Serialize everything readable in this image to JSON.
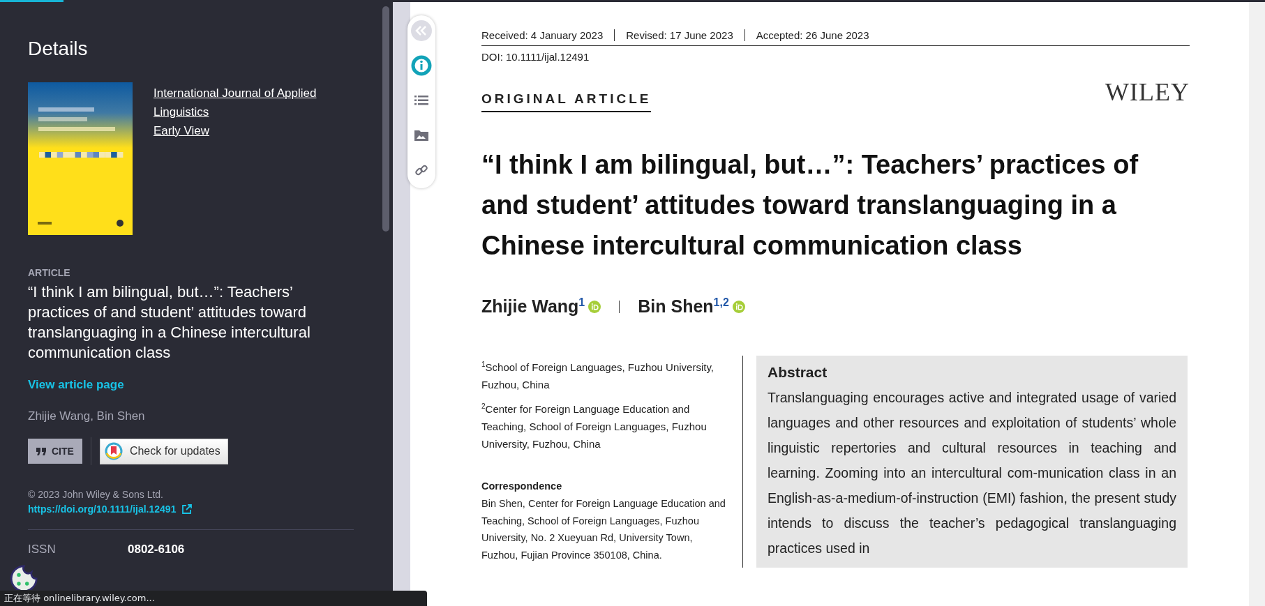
{
  "loading_bar": {
    "level": 0.05
  },
  "details": {
    "heading": "Details",
    "journal_link": "International Journal of Applied Linguistics",
    "issue_link": "Early View",
    "section_label": "ARTICLE",
    "article_title": "“I think I am bilingual, but…”: Teachers’ practices of and student’ attitudes toward translanguaging in a Chinese intercultural communication class",
    "view_link": "View article page",
    "authors": "Zhijie Wang, Bin Shen",
    "cite_button": "CITE",
    "updates_button": "Check for updates",
    "copyright": "© 2023 John Wiley & Sons Ltd.",
    "doi_link": "https://doi.org/10.1111/ijal.12491",
    "issn_label": "ISSN",
    "issn_value": "0802-6106"
  },
  "toolbar": [
    {
      "kind": "collapse",
      "selected": false
    },
    {
      "kind": "info",
      "selected": true
    },
    {
      "kind": "contents",
      "selected": false
    },
    {
      "kind": "figures",
      "selected": false
    },
    {
      "kind": "links",
      "selected": false
    }
  ],
  "article": {
    "dates": [
      "Received: 4 January 2023",
      "Revised: 17 June 2023",
      "Accepted: 26 June 2023"
    ],
    "doi": "DOI: 10.1111/ijal.12491",
    "section": "ORIGINAL ARTICLE",
    "publisher": "WILEY",
    "title": "“I think I am bilingual, but…”: Teachers’ practices of and student’ attitudes toward translanguaging in a Chinese intercultural communication class",
    "authors": [
      "Zhijie Wang$^{1}$",
      "Bin Shen$^{1,2}$"
    ],
    "affiliations": [
      "$^{1}$School of Foreign Languages, Fuzhou University, Fuzhou, China",
      "$^{2}$Center for Foreign Language Education and Teaching, School of Foreign Languages, Fuzhou University, Fuzhou, China"
    ],
    "correspondence_label": "Correspondence",
    "correspondence": "Bin Shen, Center for Foreign Language Education and Teaching, School of Foreign Languages, Fuzhou University, No. 2 Xueyuan Rd, University Town, Fuzhou, Fujian Province 350108, China.",
    "abstract_heading": "Abstract",
    "abstract": "Translanguaging encourages active and integrated usage of varied languages and other resources and exploitation of students’ whole linguistic repertories and cultural resources in teaching and learning. Zooming into an intercultural com-munication class in an English-as-a-medium-of-instruction (EMI) fashion, the present study intends to discuss the teacher’s pedagogical translanguaging practices used in"
  },
  "status_bar": "正在等待 onlinelibrary.wiley.com..."
}
